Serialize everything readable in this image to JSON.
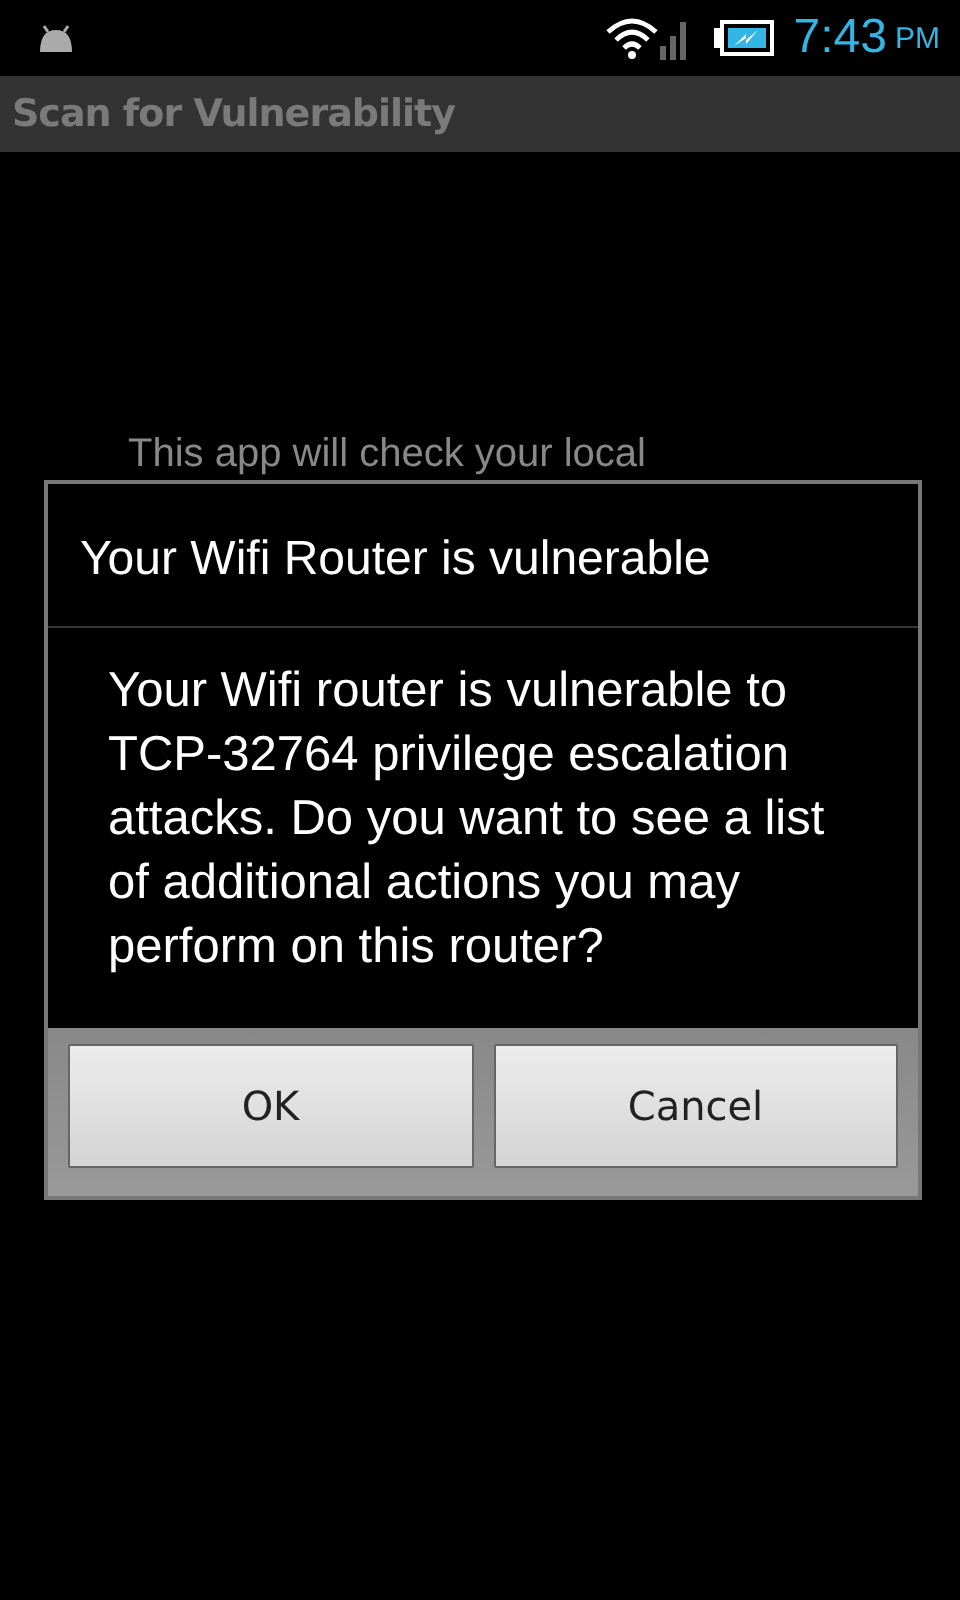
{
  "status_bar": {
    "time": "7:43",
    "ampm": "PM"
  },
  "action_bar": {
    "title": "Scan for Vulnerability"
  },
  "background_text": "This app will check your local",
  "dialog": {
    "title": "Your Wifi Router is vulnerable",
    "message": "Your Wifi router is vulnerable to TCP-32764 privilege escalation attacks.  Do you want to see a list of additional actions you may perform on this router?",
    "buttons": [
      {
        "label": "OK"
      },
      {
        "label": "Cancel"
      }
    ]
  }
}
